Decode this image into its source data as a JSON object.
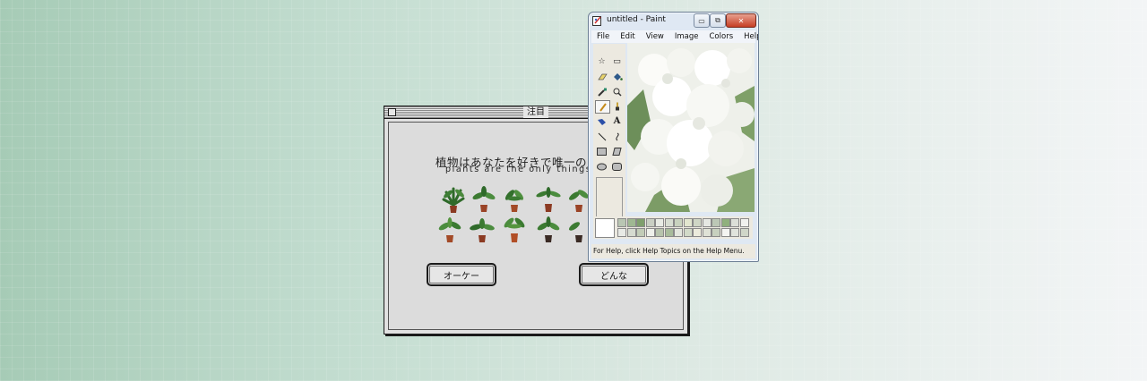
{
  "dialog": {
    "title": "注目",
    "message_jp": "植物はあなたを好きで唯一のも",
    "message_en": "plants are the only things that",
    "ok_button": "オーケー",
    "other_button": "どんな"
  },
  "paint": {
    "title": "untitled - Paint",
    "menu": [
      "File",
      "Edit",
      "View",
      "Image",
      "Colors",
      "Help"
    ],
    "status": "For Help, click Help Topics on the Help Menu.",
    "icons": {
      "window_controls": [
        "minimize-icon",
        "restore-icon",
        "close-icon"
      ],
      "tools": [
        "free-form-select-icon",
        "select-icon",
        "eraser-icon",
        "fill-icon",
        "color-picker-icon",
        "magnifier-icon",
        "pencil-icon",
        "brush-icon",
        "airbrush-icon",
        "text-icon",
        "line-icon",
        "curve-icon",
        "rectangle-icon",
        "polygon-icon",
        "ellipse-icon",
        "rounded-rectangle-icon"
      ]
    },
    "palette_colors": [
      "#b9c6b3",
      "#9fb892",
      "#7f9f6d",
      "#c9cfc3",
      "#e8ebe4",
      "#d7ddd1",
      "#c8d2be",
      "#e2e6cf",
      "#cfd6c5",
      "#e6e8e3",
      "#bcc7b6",
      "#90b07d",
      "#dcdfd8",
      "#f1f1ee",
      "#e8eae5",
      "#d6dbd0",
      "#c2ccb7",
      "#eef0ea",
      "#b7c3ac",
      "#a8bb9b",
      "#e3e6dd",
      "#d2dac8",
      "#ecebdc",
      "#dfe2d6",
      "#c7d0be",
      "#f4f4f1",
      "#e0e3dc",
      "#d0d6c8"
    ]
  }
}
